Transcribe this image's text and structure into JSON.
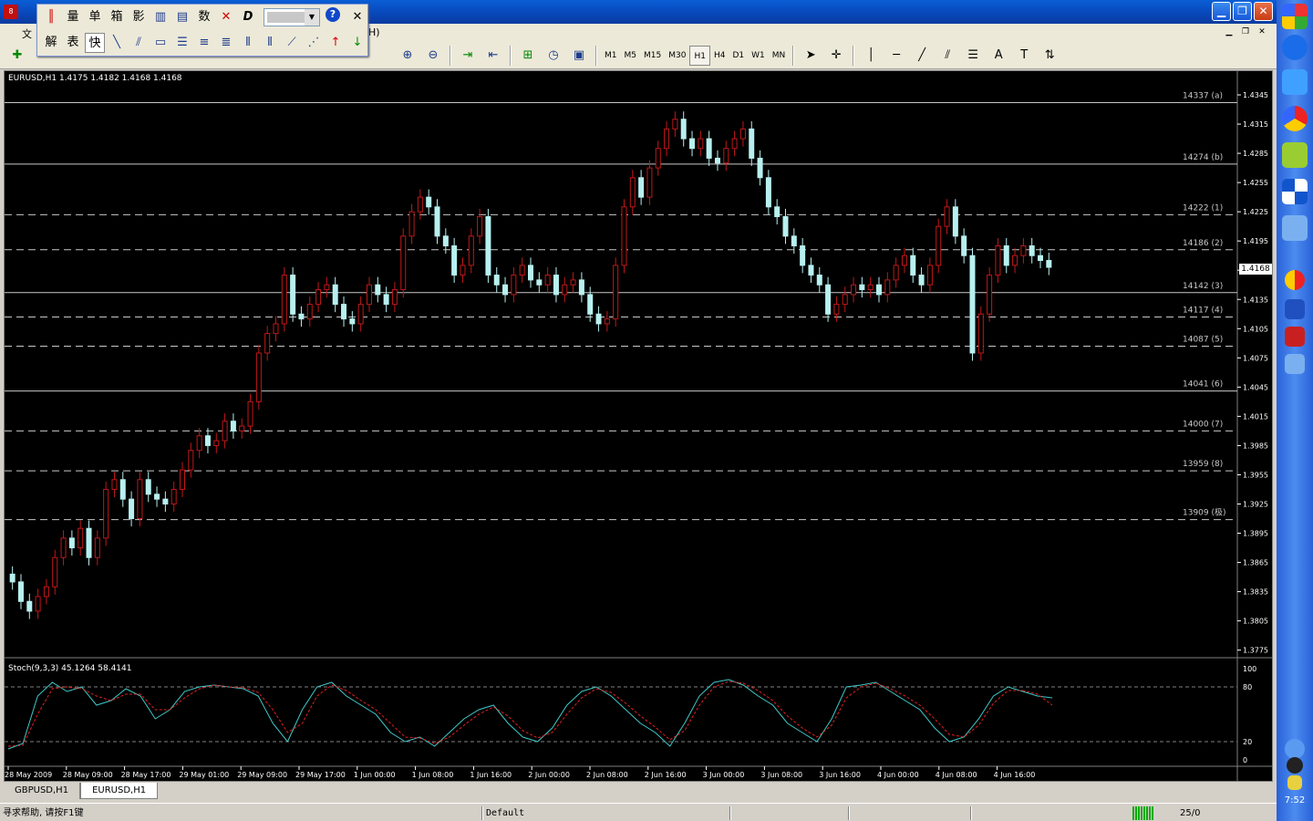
{
  "window": {
    "title_fragment": "8",
    "menu_fragment_1": "文",
    "menu_fragment_2": "H)",
    "bracket_fragment": "]"
  },
  "float_toolbar": {
    "row1": [
      "量",
      "单",
      "箱",
      "影",
      "数"
    ],
    "row2": [
      "解",
      "表",
      "快"
    ]
  },
  "timeframes": [
    "M1",
    "M5",
    "M15",
    "M30",
    "H1",
    "H4",
    "D1",
    "W1",
    "MN"
  ],
  "active_timeframe": "H1",
  "chart": {
    "header": "EURUSD,H1  1.4175 1.4182 1.4168 1.4168",
    "current_price": "1.4168",
    "indicator_label": "Stoch(9,3,3) 45.1264 58.4141"
  },
  "chart_data": {
    "type": "candlestick",
    "symbol": "EURUSD",
    "timeframe": "H1",
    "ylim": [
      1.377,
      1.436
    ],
    "y_ticks": [
      "1.4345",
      "1.4315",
      "1.4285",
      "1.4255",
      "1.4225",
      "1.4195",
      "1.4165",
      "1.4135",
      "1.4105",
      "1.4075",
      "1.4045",
      "1.4015",
      "1.3985",
      "1.3955",
      "1.3925",
      "1.3895",
      "1.3865",
      "1.3835",
      "1.3805",
      "1.3775"
    ],
    "x_ticks": [
      "28 May 2009",
      "28 May 09:00",
      "28 May 17:00",
      "29 May 01:00",
      "29 May 09:00",
      "29 May 17:00",
      "1 Jun 00:00",
      "1 Jun 08:00",
      "1 Jun 16:00",
      "2 Jun 00:00",
      "2 Jun 08:00",
      "2 Jun 16:00",
      "3 Jun 00:00",
      "3 Jun 08:00",
      "3 Jun 16:00",
      "4 Jun 00:00",
      "4 Jun 08:00",
      "4 Jun 16:00"
    ],
    "levels": [
      {
        "price": 1.4337,
        "label": "14337 (a)",
        "style": "solid"
      },
      {
        "price": 1.4274,
        "label": "14274 (b)",
        "style": "solid"
      },
      {
        "price": 1.4222,
        "label": "14222 (1)",
        "style": "dashed"
      },
      {
        "price": 1.4186,
        "label": "14186 (2)",
        "style": "dashed"
      },
      {
        "price": 1.4142,
        "label": "14142 (3)",
        "style": "solid"
      },
      {
        "price": 1.4117,
        "label": "14117 (4)",
        "style": "dashed"
      },
      {
        "price": 1.4087,
        "label": "14087 (5)",
        "style": "dashed"
      },
      {
        "price": 1.4041,
        "label": "14041 (6)",
        "style": "solid"
      },
      {
        "price": 1.4,
        "label": "14000 (7)",
        "style": "dashed"
      },
      {
        "price": 1.3959,
        "label": "13959 (8)",
        "style": "dashed"
      },
      {
        "price": 1.3909,
        "label": "13909 (极)",
        "style": "dashed"
      }
    ],
    "closes": [
      1.3845,
      1.3825,
      1.3815,
      1.383,
      1.384,
      1.387,
      1.389,
      1.388,
      1.39,
      1.387,
      1.389,
      1.394,
      1.395,
      1.393,
      1.391,
      1.395,
      1.3935,
      1.393,
      1.3925,
      1.394,
      1.396,
      1.398,
      1.3995,
      1.3985,
      1.399,
      1.401,
      1.4,
      1.4005,
      1.403,
      1.408,
      1.41,
      1.411,
      1.416,
      1.412,
      1.4115,
      1.413,
      1.4145,
      1.415,
      1.413,
      1.4115,
      1.411,
      1.413,
      1.415,
      1.414,
      1.413,
      1.4145,
      1.42,
      1.4225,
      1.424,
      1.423,
      1.42,
      1.419,
      1.416,
      1.417,
      1.42,
      1.422,
      1.416,
      1.415,
      1.414,
      1.416,
      1.417,
      1.4155,
      1.415,
      1.416,
      1.414,
      1.415,
      1.4155,
      1.414,
      1.412,
      1.411,
      1.4115,
      1.417,
      1.423,
      1.426,
      1.424,
      1.427,
      1.429,
      1.431,
      1.432,
      1.43,
      1.429,
      1.43,
      1.428,
      1.4275,
      1.429,
      1.43,
      1.431,
      1.428,
      1.426,
      1.423,
      1.422,
      1.42,
      1.419,
      1.417,
      1.416,
      1.415,
      1.412,
      1.413,
      1.414,
      1.415,
      1.4145,
      1.415,
      1.414,
      1.4155,
      1.417,
      1.418,
      1.416,
      1.415,
      1.417,
      1.421,
      1.423,
      1.42,
      1.418,
      1.408,
      1.412,
      1.416,
      1.419,
      1.417,
      1.418,
      1.419,
      1.418,
      1.4175,
      1.4168
    ],
    "stoch_main": [
      12,
      18,
      70,
      85,
      75,
      80,
      60,
      65,
      78,
      70,
      45,
      55,
      75,
      80,
      82,
      80,
      78,
      70,
      40,
      20,
      55,
      80,
      85,
      70,
      60,
      50,
      30,
      20,
      25,
      15,
      30,
      45,
      55,
      60,
      40,
      25,
      20,
      35,
      60,
      75,
      80,
      70,
      55,
      40,
      30,
      15,
      40,
      70,
      85,
      88,
      82,
      70,
      60,
      40,
      30,
      20,
      45,
      80,
      82,
      85,
      75,
      65,
      55,
      35,
      20,
      25,
      45,
      70,
      80,
      75,
      70,
      68
    ],
    "stoch_signal": [
      15,
      16,
      50,
      78,
      80,
      78,
      70,
      65,
      72,
      72,
      55,
      55,
      68,
      78,
      82,
      80,
      79,
      74,
      55,
      30,
      40,
      70,
      82,
      76,
      65,
      55,
      40,
      25,
      24,
      18,
      25,
      38,
      50,
      58,
      48,
      32,
      24,
      30,
      50,
      68,
      78,
      74,
      62,
      48,
      36,
      22,
      32,
      60,
      80,
      86,
      84,
      76,
      65,
      48,
      35,
      25,
      38,
      68,
      80,
      84,
      78,
      70,
      60,
      45,
      28,
      25,
      38,
      62,
      76,
      76,
      72,
      60
    ]
  }
}
